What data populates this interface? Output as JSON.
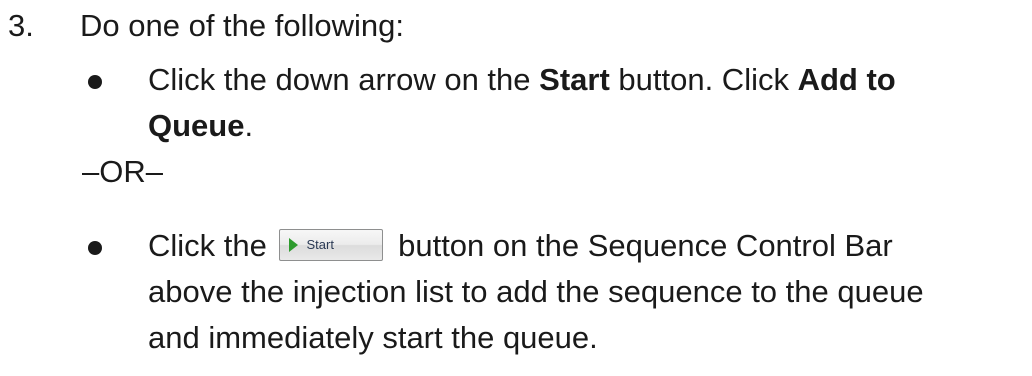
{
  "step": {
    "number": "3.",
    "text": "Do one of the following:"
  },
  "option1": {
    "t1": "Click the down arrow on the ",
    "b1": "Start",
    "t2": " button. Click ",
    "b2": "Add to",
    "b3": "Queue",
    "t3": "."
  },
  "separator": "–OR–",
  "option2": {
    "t1": "Click the ",
    "button_label": "Start",
    "button_icon": "play-icon",
    "t2": " button on the Sequence Control Bar",
    "line2": "above the injection list to add the sequence to the queue",
    "line3": "and immediately start the queue."
  }
}
